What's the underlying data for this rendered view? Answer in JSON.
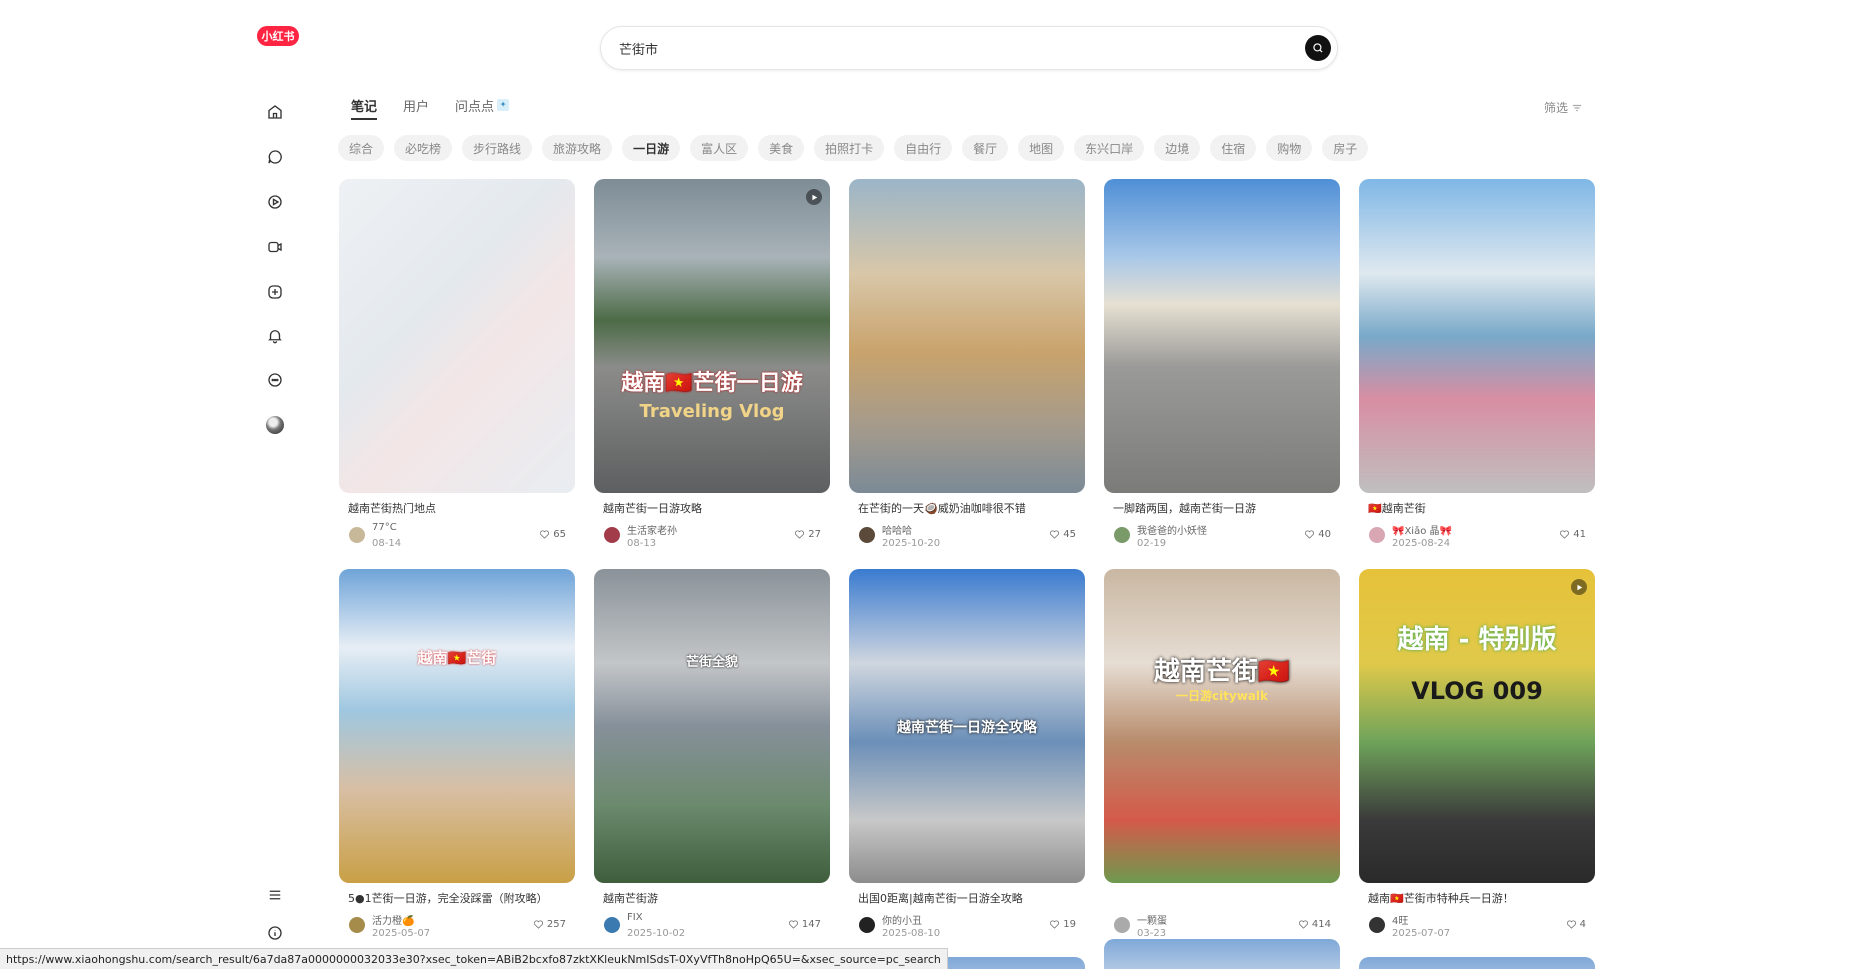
{
  "logo": {
    "text": "小红书"
  },
  "search": {
    "value": "芒街市"
  },
  "tabs": [
    {
      "label": "笔记",
      "active": true
    },
    {
      "label": "用户",
      "active": false
    },
    {
      "label": "问点点",
      "active": false
    }
  ],
  "filter_label": "筛选",
  "chips": [
    {
      "label": "综合",
      "active": false
    },
    {
      "label": "必吃榜",
      "active": false
    },
    {
      "label": "步行路线",
      "active": false
    },
    {
      "label": "旅游攻略",
      "active": false
    },
    {
      "label": "一日游",
      "active": true
    },
    {
      "label": "富人区",
      "active": false
    },
    {
      "label": "美食",
      "active": false
    },
    {
      "label": "拍照打卡",
      "active": false
    },
    {
      "label": "自由行",
      "active": false
    },
    {
      "label": "餐厅",
      "active": false
    },
    {
      "label": "地图",
      "active": false
    },
    {
      "label": "东兴口岸",
      "active": false
    },
    {
      "label": "边境",
      "active": false
    },
    {
      "label": "住宿",
      "active": false
    },
    {
      "label": "购物",
      "active": false
    },
    {
      "label": "房子",
      "active": false
    }
  ],
  "cards": [
    {
      "title": "越南芒街热门地点",
      "author": "77°C",
      "date": "08-14",
      "likes": "65",
      "video": false,
      "overlay": "",
      "overlay2": ""
    },
    {
      "title": "越南芒街一日游攻略",
      "author": "生活家老孙",
      "date": "08-13",
      "likes": "27",
      "video": true,
      "overlay": "越南🇻🇳芒街一日游",
      "overlay2": "Traveling Vlog"
    },
    {
      "title": "在芒街的一天🥥威奶油咖啡很不错",
      "author": "哈哈哈",
      "date": "2025-10-20",
      "likes": "45",
      "video": false,
      "overlay": "",
      "overlay2": ""
    },
    {
      "title": "一脚踏两国，越南芒街一日游",
      "author": "我爸爸的小妖怪",
      "date": "02-19",
      "likes": "40",
      "video": false,
      "overlay": "",
      "overlay2": ""
    },
    {
      "title": "🇻🇳越南芒街",
      "author": "🎀Xiǎo 晶🎀",
      "date": "2025-08-24",
      "likes": "41",
      "video": false,
      "overlay": "",
      "overlay2": ""
    },
    {
      "title": "5●1芒街一日游，完全没踩雷（附攻略）",
      "author": "活力橙🍊",
      "date": "2025-05-07",
      "likes": "257",
      "video": false,
      "overlay": "越南🇻🇳芒街",
      "overlay2": ""
    },
    {
      "title": "越南芒街游",
      "author": "FIX",
      "date": "2025-10-02",
      "likes": "147",
      "video": false,
      "overlay": "芒街全貌",
      "overlay2": ""
    },
    {
      "title": "出国0距离|越南芒街一日游全攻略",
      "author": "你的小丑",
      "date": "2025-08-10",
      "likes": "19",
      "video": false,
      "overlay": "越南芒街一日游全攻略",
      "overlay2": ""
    },
    {
      "title": "",
      "author": "一颗蛋",
      "date": "03-23",
      "likes": "414",
      "video": false,
      "overlay": "越南芒街🇻🇳",
      "overlay2": "一日游citywalk"
    },
    {
      "title": "越南🇻🇳芒街市特种兵一日游！",
      "author": "4旺",
      "date": "2025-07-07",
      "likes": "4",
      "video": true,
      "overlay": "越南 - 特别版",
      "overlay2": "VLOG 009"
    }
  ],
  "status_url": "https://www.xiaohongshu.com/search_result/6a7da87a0000000032033e30?xsec_token=ABiB2bcxfo87zktXKleukNmISdsT-0XyVfTh8noHpQ65U=&xsec_source=pc_search"
}
